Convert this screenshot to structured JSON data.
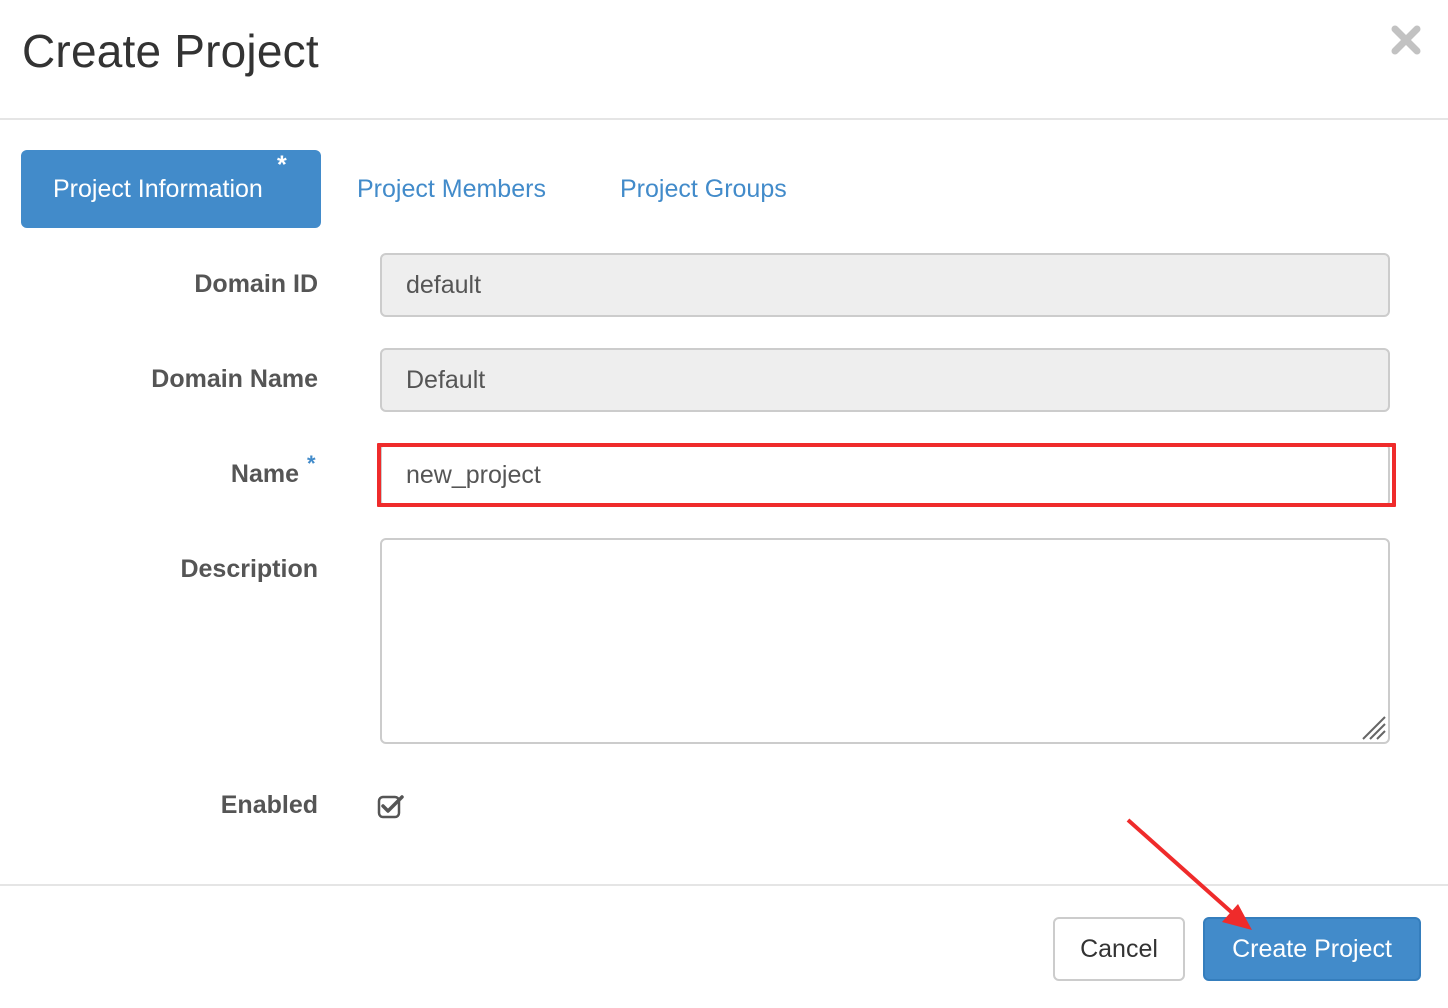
{
  "modal": {
    "title": "Create Project",
    "close_icon": "close-icon"
  },
  "tabs": [
    {
      "label": "Project Information",
      "required_mark": "*",
      "active": true
    },
    {
      "label": "Project Members",
      "active": false
    },
    {
      "label": "Project Groups",
      "active": false
    }
  ],
  "form": {
    "domain_id": {
      "label": "Domain ID",
      "value": "default"
    },
    "domain_name": {
      "label": "Domain Name",
      "value": "Default"
    },
    "name": {
      "label": "Name",
      "required_mark": "*",
      "value": "new_project"
    },
    "description": {
      "label": "Description",
      "value": ""
    },
    "enabled": {
      "label": "Enabled",
      "checked": true
    }
  },
  "footer": {
    "cancel_label": "Cancel",
    "submit_label": "Create Project"
  },
  "colors": {
    "primary": "#428bca",
    "annotation": "#ef2b2b",
    "readonly_bg": "#eeeeee"
  }
}
